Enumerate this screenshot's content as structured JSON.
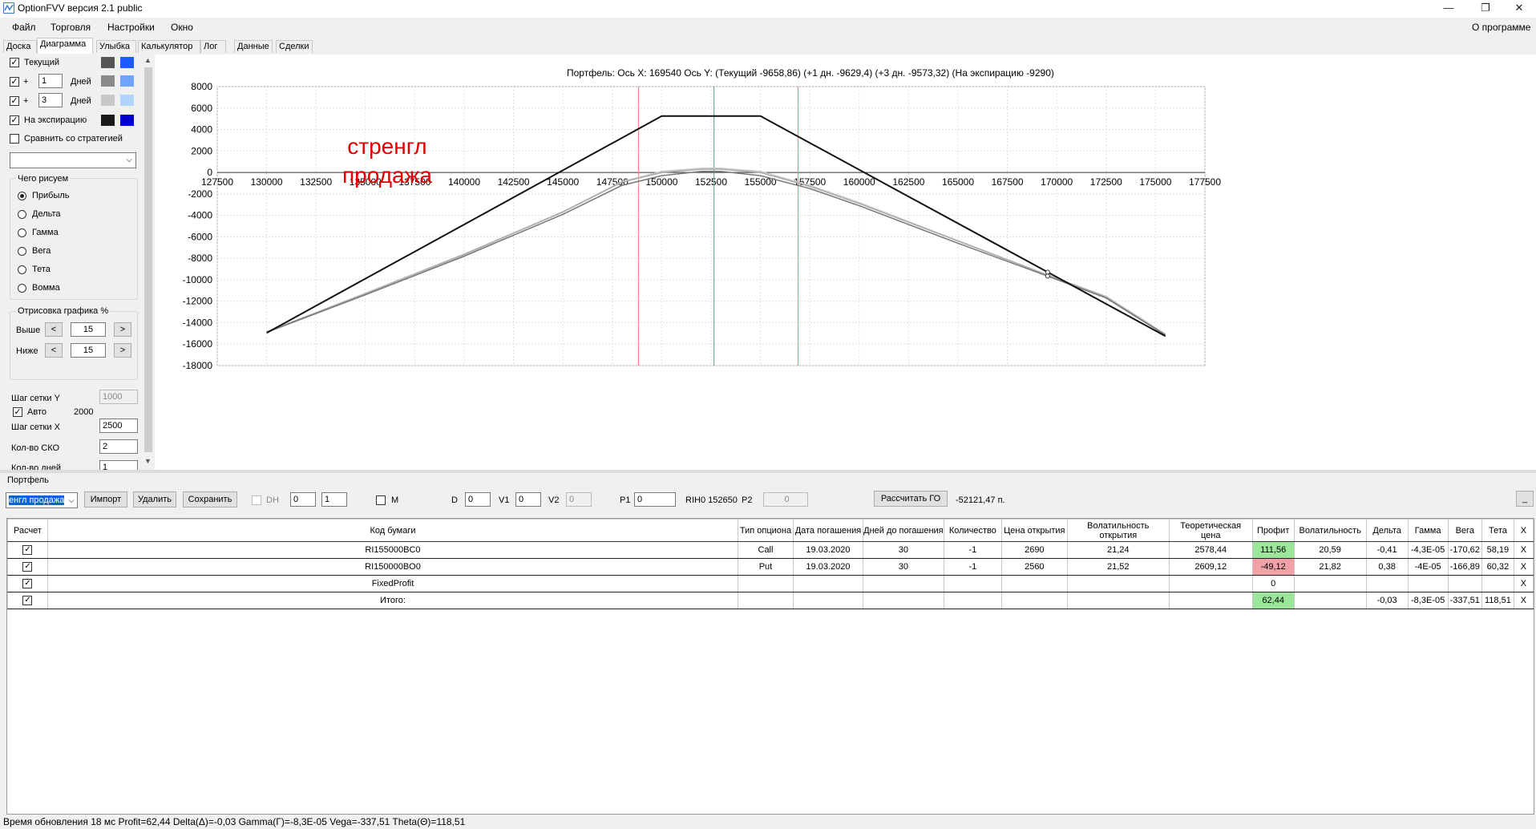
{
  "window": {
    "title": "OptionFVV версия 2.1 public",
    "minimize": "—",
    "restore": "❐",
    "close": "✕"
  },
  "menu": {
    "file": "Файл",
    "trade": "Торговля",
    "settings": "Настройки",
    "window": "Окно",
    "about": "О программе"
  },
  "tabs": [
    "Доска",
    "Диаграмма",
    "Улыбка",
    "Калькулятор",
    "Лог",
    "Данные",
    "Сделки"
  ],
  "left": {
    "current_label": "Текущий",
    "plus": "+",
    "plus_days_1": "1",
    "plus_days_2": "3",
    "days_label": "Дней",
    "expiry_label": "На экспирацию",
    "compare_label": "Сравнить со стратегией",
    "draw_group": "Чего рисуем",
    "radios": [
      "Прибыль",
      "Дельта",
      "Гамма",
      "Вега",
      "Тета",
      "Вомма"
    ],
    "range_group": "Отрисовка графика %",
    "above_label": "Выше",
    "below_label": "Ниже",
    "above_value": "15",
    "below_value": "15",
    "left_arrow": "<",
    "right_arrow": ">",
    "grid_y_label": "Шаг сетки Y",
    "grid_y_value": "1000",
    "auto_label": "Авто",
    "auto_value": "2000",
    "grid_x_label": "Шаг сетки X",
    "grid_x_value": "2500",
    "sko_label": "Кол-во СКО",
    "sko_value": "2",
    "days_count_label": "Кол-во дней",
    "days_count_value": "1",
    "swatch_colors": {
      "current": [
        "#555555",
        "#1c5cff"
      ],
      "plus1": [
        "#8a8a8a",
        "#6fa3ff"
      ],
      "plus3": [
        "#c8c8c8",
        "#b0d6ff"
      ],
      "expiry": [
        "#1a1a1a",
        "#0000c8"
      ]
    }
  },
  "chart": {
    "header": "Портфель: Ось X:  169540  Ось Y:   (Текущий -9658,86)  (+1 дн.  -9629,4)  (+3 дн.  -9573,32)  (На экспирацию -9290)",
    "annotation": "стренгл\nпродажа"
  },
  "chart_data": {
    "type": "line",
    "xlim": [
      127500,
      177500
    ],
    "ylim": [
      -18000,
      8000
    ],
    "x_ticks": [
      127500,
      130000,
      132500,
      135000,
      137500,
      140000,
      142500,
      145000,
      147500,
      150000,
      152500,
      155000,
      157500,
      160000,
      162500,
      165000,
      167500,
      170000,
      172500,
      175000,
      177500
    ],
    "y_ticks": [
      8000,
      6000,
      4000,
      2000,
      0,
      -2000,
      -4000,
      -6000,
      -8000,
      -10000,
      -12000,
      -14000,
      -16000,
      -18000
    ],
    "grid": true,
    "vertical_markers": [
      {
        "x": 148830,
        "color": "#f08080"
      },
      {
        "x": 152650,
        "color": "#5a9090"
      },
      {
        "x": 156900,
        "color": "#f08080"
      }
    ],
    "series": [
      {
        "color": "#111111",
        "points": [
          [
            130000,
            -14950
          ],
          [
            150000,
            5250
          ],
          [
            155000,
            5250
          ],
          [
            175500,
            -15250
          ]
        ]
      },
      {
        "color": "#777777",
        "points": [
          [
            130000,
            -14900
          ],
          [
            135000,
            -11400
          ],
          [
            140000,
            -7800
          ],
          [
            145000,
            -3900
          ],
          [
            148000,
            -1200
          ],
          [
            150000,
            -300
          ],
          [
            152000,
            100
          ],
          [
            153000,
            100
          ],
          [
            155000,
            -300
          ],
          [
            157500,
            -1500
          ],
          [
            160000,
            -3100
          ],
          [
            165000,
            -6600
          ],
          [
            169540,
            -9659
          ],
          [
            172500,
            -11700
          ],
          [
            175500,
            -15150
          ]
        ]
      },
      {
        "color": "#aaaaaa",
        "points": [
          [
            130000,
            -14850
          ],
          [
            135000,
            -11300
          ],
          [
            140000,
            -7650
          ],
          [
            145000,
            -3700
          ],
          [
            148000,
            -900
          ],
          [
            150000,
            0
          ],
          [
            152000,
            300
          ],
          [
            153000,
            300
          ],
          [
            155000,
            0
          ],
          [
            157500,
            -1300
          ],
          [
            160000,
            -2900
          ],
          [
            165000,
            -6400
          ],
          [
            169540,
            -9573
          ],
          [
            172500,
            -11600
          ],
          [
            175500,
            -15100
          ]
        ]
      },
      {
        "color": "#cccccc",
        "points": [
          [
            130000,
            -14850
          ],
          [
            135000,
            -11250
          ],
          [
            140000,
            -7600
          ],
          [
            145000,
            -3650
          ],
          [
            148000,
            -850
          ],
          [
            150000,
            100
          ],
          [
            152000,
            400
          ],
          [
            153000,
            400
          ],
          [
            155000,
            100
          ],
          [
            157500,
            -1200
          ],
          [
            160000,
            -2800
          ],
          [
            165000,
            -6350
          ],
          [
            169540,
            -9550
          ],
          [
            172500,
            -11550
          ],
          [
            175500,
            -15050
          ]
        ]
      }
    ],
    "markers": [
      [
        169540,
        -9290
      ],
      [
        169540,
        -9659
      ]
    ]
  },
  "portfolio": {
    "label": "Портфель",
    "selected": "енгл продажа",
    "import": "Импорт",
    "delete": "Удалить",
    "save": "Сохранить",
    "dh_label": "DH",
    "spin1": "0",
    "spin2": "1",
    "m_label": "M",
    "d_label": "D",
    "d_value": "0",
    "v1_label": "V1",
    "v1_value": "0",
    "v2_label": "V2",
    "v2_value": "0",
    "p1_label": "P1",
    "p1_value": "0",
    "rih_label": "RIH0 152650",
    "p2_label": "P2",
    "p2_value": "0",
    "calc_button": "Рассчитать ГО",
    "go_value": "-52121,47 п.",
    "collapse": "_"
  },
  "table": {
    "headers": [
      "Расчет",
      "Код бумаги",
      "Тип опциона",
      "Дата погашения",
      "Дней до погашения",
      "Количество",
      "Цена открытия",
      "Волатильность открытия",
      "Теоретическая цена",
      "Профит",
      "Волатильность",
      "Дельта",
      "Гамма",
      "Вега",
      "Тета",
      "X"
    ],
    "rows": [
      [
        "✓",
        "RI155000BC0",
        "Call",
        "19.03.2020",
        "30",
        "-1",
        "2690",
        "21,24",
        "2578,44",
        "111,56",
        "20,59",
        "-0,41",
        "-4,3E-05",
        "-170,62",
        "58,19",
        "X"
      ],
      [
        "✓",
        "RI150000BO0",
        "Put",
        "19.03.2020",
        "30",
        "-1",
        "2560",
        "21,52",
        "2609,12",
        "-49,12",
        "21,82",
        "0,38",
        "-4E-05",
        "-166,89",
        "60,32",
        "X"
      ],
      [
        "✓",
        "FixedProfit",
        "",
        "",
        "",
        "",
        "",
        "",
        "",
        "0",
        "",
        "",
        "",
        "",
        "",
        "X"
      ],
      [
        "✓",
        "Итого:",
        "",
        "",
        "",
        "",
        "",
        "",
        "",
        "62,44",
        "",
        "-0,03",
        "-8,3E-05",
        "-337,51",
        "118,51",
        "X"
      ]
    ]
  },
  "status": {
    "text": "Время обновления 18 мс  Profit=62,44 Delta(Δ)=-0,03 Gamma(Γ)=-8,3E-05 Vega=-337,51 Theta(Θ)=118,51"
  }
}
